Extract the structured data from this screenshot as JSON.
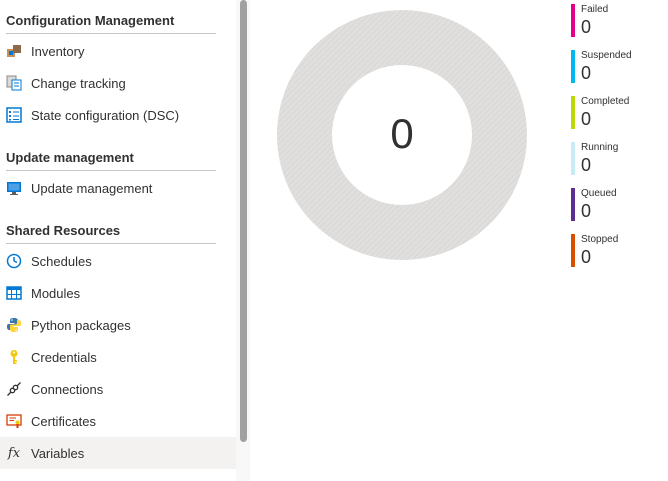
{
  "sidebar": {
    "sections": {
      "config": "Configuration Management",
      "update": "Update management",
      "shared": "Shared Resources"
    },
    "items": {
      "inventory": "Inventory",
      "change_tracking": "Change tracking",
      "state_config": "State configuration (DSC)",
      "update_management": "Update management",
      "schedules": "Schedules",
      "modules": "Modules",
      "python_packages": "Python packages",
      "credentials": "Credentials",
      "connections": "Connections",
      "certificates": "Certificates",
      "variables": "Variables"
    },
    "variables_icon_text": "fx",
    "selected": "variables"
  },
  "jobs_summary": {
    "total": "0",
    "legend": [
      {
        "label": "Failed",
        "value": "0",
        "color": "#e3008c"
      },
      {
        "label": "Suspended",
        "value": "0",
        "color": "#00b7ee"
      },
      {
        "label": "Completed",
        "value": "0",
        "color": "#bad80a"
      },
      {
        "label": "Running",
        "value": "0",
        "color": "#c7ecf6"
      },
      {
        "label": "Queued",
        "value": "0",
        "color": "#5c2d91"
      },
      {
        "label": "Stopped",
        "value": "0",
        "color": "#d94f00"
      }
    ]
  }
}
